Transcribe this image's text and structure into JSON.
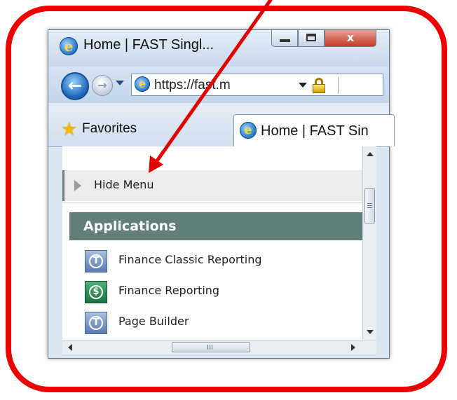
{
  "window": {
    "title": "Home | FAST Singl...",
    "close_glyph": "x"
  },
  "navigation": {
    "back_glyph": "←",
    "forward_glyph": "→",
    "address": "https://fast.m"
  },
  "favorites_bar": {
    "favorites_label": "Favorites",
    "tab_label": "Home | FAST Sin"
  },
  "page": {
    "hide_menu_label": "Hide Menu",
    "applications_header": "Applications",
    "apps": [
      {
        "label": "Finance Classic Reporting",
        "icon": "finance-classic-icon"
      },
      {
        "label": "Finance Reporting",
        "icon": "dollar-icon"
      },
      {
        "label": "Page Builder",
        "icon": "page-builder-icon"
      }
    ]
  },
  "annotation": {
    "arrow_color": "#e00000",
    "frame_color": "#ee0000"
  }
}
